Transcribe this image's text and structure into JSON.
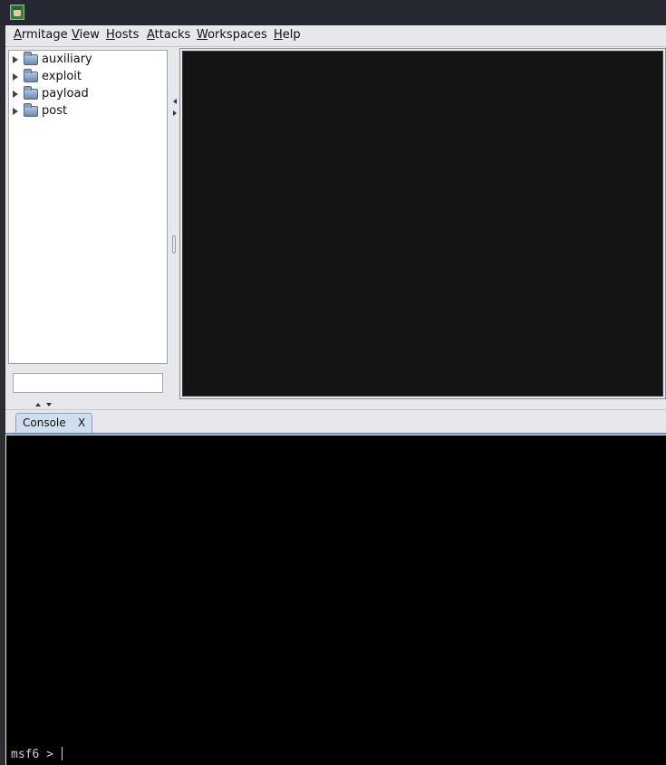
{
  "menubar": {
    "items": [
      "Armitage",
      "View",
      "Hosts",
      "Attacks",
      "Workspaces",
      "Help"
    ]
  },
  "module_tree": {
    "items": [
      {
        "label": "auxiliary",
        "icon": "folder-icon"
      },
      {
        "label": "exploit",
        "icon": "folder-icon"
      },
      {
        "label": "payload",
        "icon": "folder-icon"
      },
      {
        "label": "post",
        "icon": "folder-icon"
      }
    ],
    "search": {
      "value": "",
      "placeholder": ""
    }
  },
  "tabs": [
    {
      "label": "Console",
      "close": "X"
    }
  ],
  "console": {
    "prompt": "msf6 > "
  },
  "colors": {
    "titlebar": "#252830",
    "panel_background": "#e6e8ec",
    "targets_background": "#141414",
    "console_background": "#000000",
    "console_text": "#cfcfcf",
    "tab_background": "#cfdff0"
  }
}
